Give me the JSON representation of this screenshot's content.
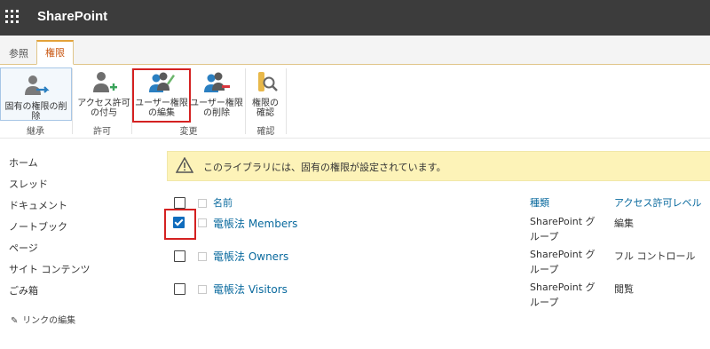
{
  "app": {
    "title": "SharePoint"
  },
  "tabs": [
    {
      "label": "参照"
    },
    {
      "label": "権限"
    }
  ],
  "ribbon": {
    "buttons": [
      {
        "label1": "固有の権限の削除",
        "label2": ""
      },
      {
        "label1": "アクセス許可",
        "label2": "の付与"
      },
      {
        "label1": "ユーザー権限",
        "label2": "の編集"
      },
      {
        "label1": "ユーザー権限",
        "label2": "の削除"
      },
      {
        "label1": "権限の",
        "label2": "確認"
      }
    ],
    "groups": [
      {
        "label": "継承"
      },
      {
        "label": "許可"
      },
      {
        "label": "変更"
      },
      {
        "label": "確認"
      }
    ]
  },
  "left_nav": {
    "items": [
      {
        "label": "ホーム"
      },
      {
        "label": "スレッド"
      },
      {
        "label": "ドキュメント"
      },
      {
        "label": "ノートブック"
      },
      {
        "label": "ページ"
      },
      {
        "label": "サイト コンテンツ"
      },
      {
        "label": "ごみ箱"
      }
    ],
    "edit_links": "リンクの編集"
  },
  "banner": {
    "text": "このライブラリには、固有の権限が設定されています。"
  },
  "table": {
    "headers": {
      "name": "名前",
      "type": "種類",
      "level": "アクセス許可レベル"
    },
    "rows": [
      {
        "name": "電帳法 Members",
        "type1": "SharePoint グ",
        "type2": "ループ",
        "level": "編集",
        "checked": true
      },
      {
        "name": "電帳法 Owners",
        "type1": "SharePoint グ",
        "type2": "ループ",
        "level": "フル コントロール",
        "checked": false
      },
      {
        "name": "電帳法 Visitors",
        "type1": "SharePoint グ",
        "type2": "ループ",
        "level": "閲覧",
        "checked": false
      }
    ]
  },
  "colors": {
    "topbar": "#3c3c3c",
    "link": "#0a6a9e",
    "accent_tab": "#c8550f",
    "highlight": "#d42121",
    "banner": "#fdf3b8",
    "checkbox": "#0f6cbd"
  }
}
